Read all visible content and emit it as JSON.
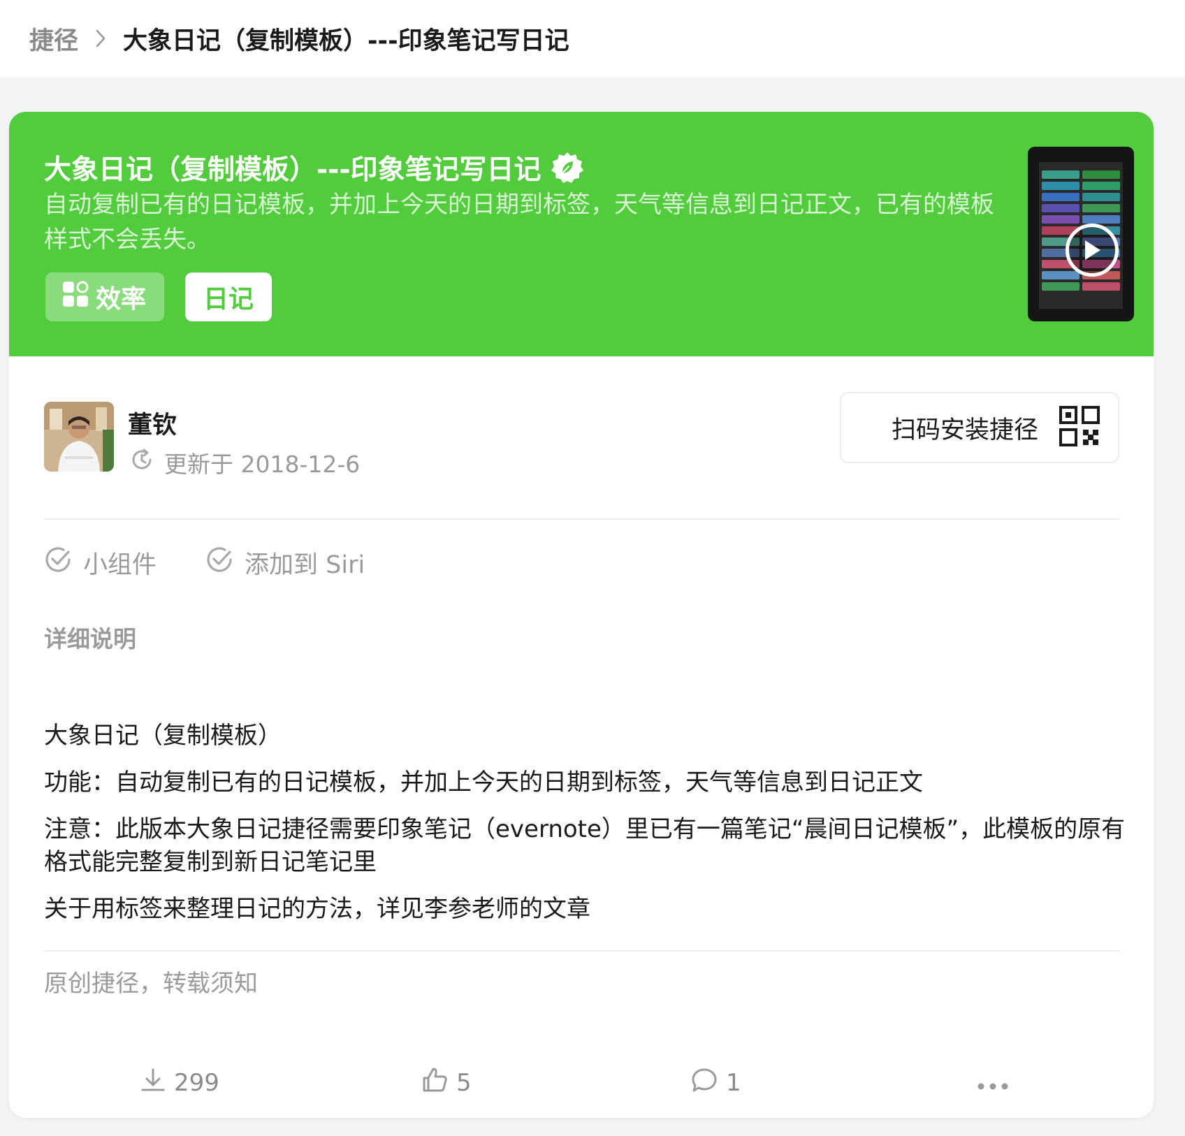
{
  "breadcrumb": {
    "root": "捷径",
    "current": "大象日记（复制模板）---印象笔记写日记"
  },
  "hero": {
    "title": "大象日记（复制模板）---印象笔记写日记",
    "description": "自动复制已有的日记模板，并加上今天的日期到标签，天气等信息到日记正文，已有的模板样式不会丢失。",
    "background_color": "#52cc3d",
    "tags": [
      {
        "label": "效率",
        "icon": "apps-icon"
      },
      {
        "label": "日记"
      }
    ]
  },
  "author": {
    "name": "董钦",
    "updated": "更新于 2018-12-6"
  },
  "qr_button": {
    "label": "扫码安装捷径"
  },
  "features": [
    "小组件",
    "添加到 Siri"
  ],
  "details": {
    "title": "详细说明",
    "lines": [
      "大象日记（复制模板）",
      "功能：自动复制已有的日记模板，并加上今天的日期到标签，天气等信息到日记正文",
      "注意：此版本大象日记捷径需要印象笔记（evernote）里已有一篇笔记“晨间日记模板”，此模板的原有格式能完整复制到新日记笔记里",
      "关于用标签来整理日记的方法，详见李参老师的文章"
    ]
  },
  "original_note": "原创捷径，转载须知",
  "stats": {
    "downloads": "299",
    "likes": "5",
    "comments": "1"
  }
}
